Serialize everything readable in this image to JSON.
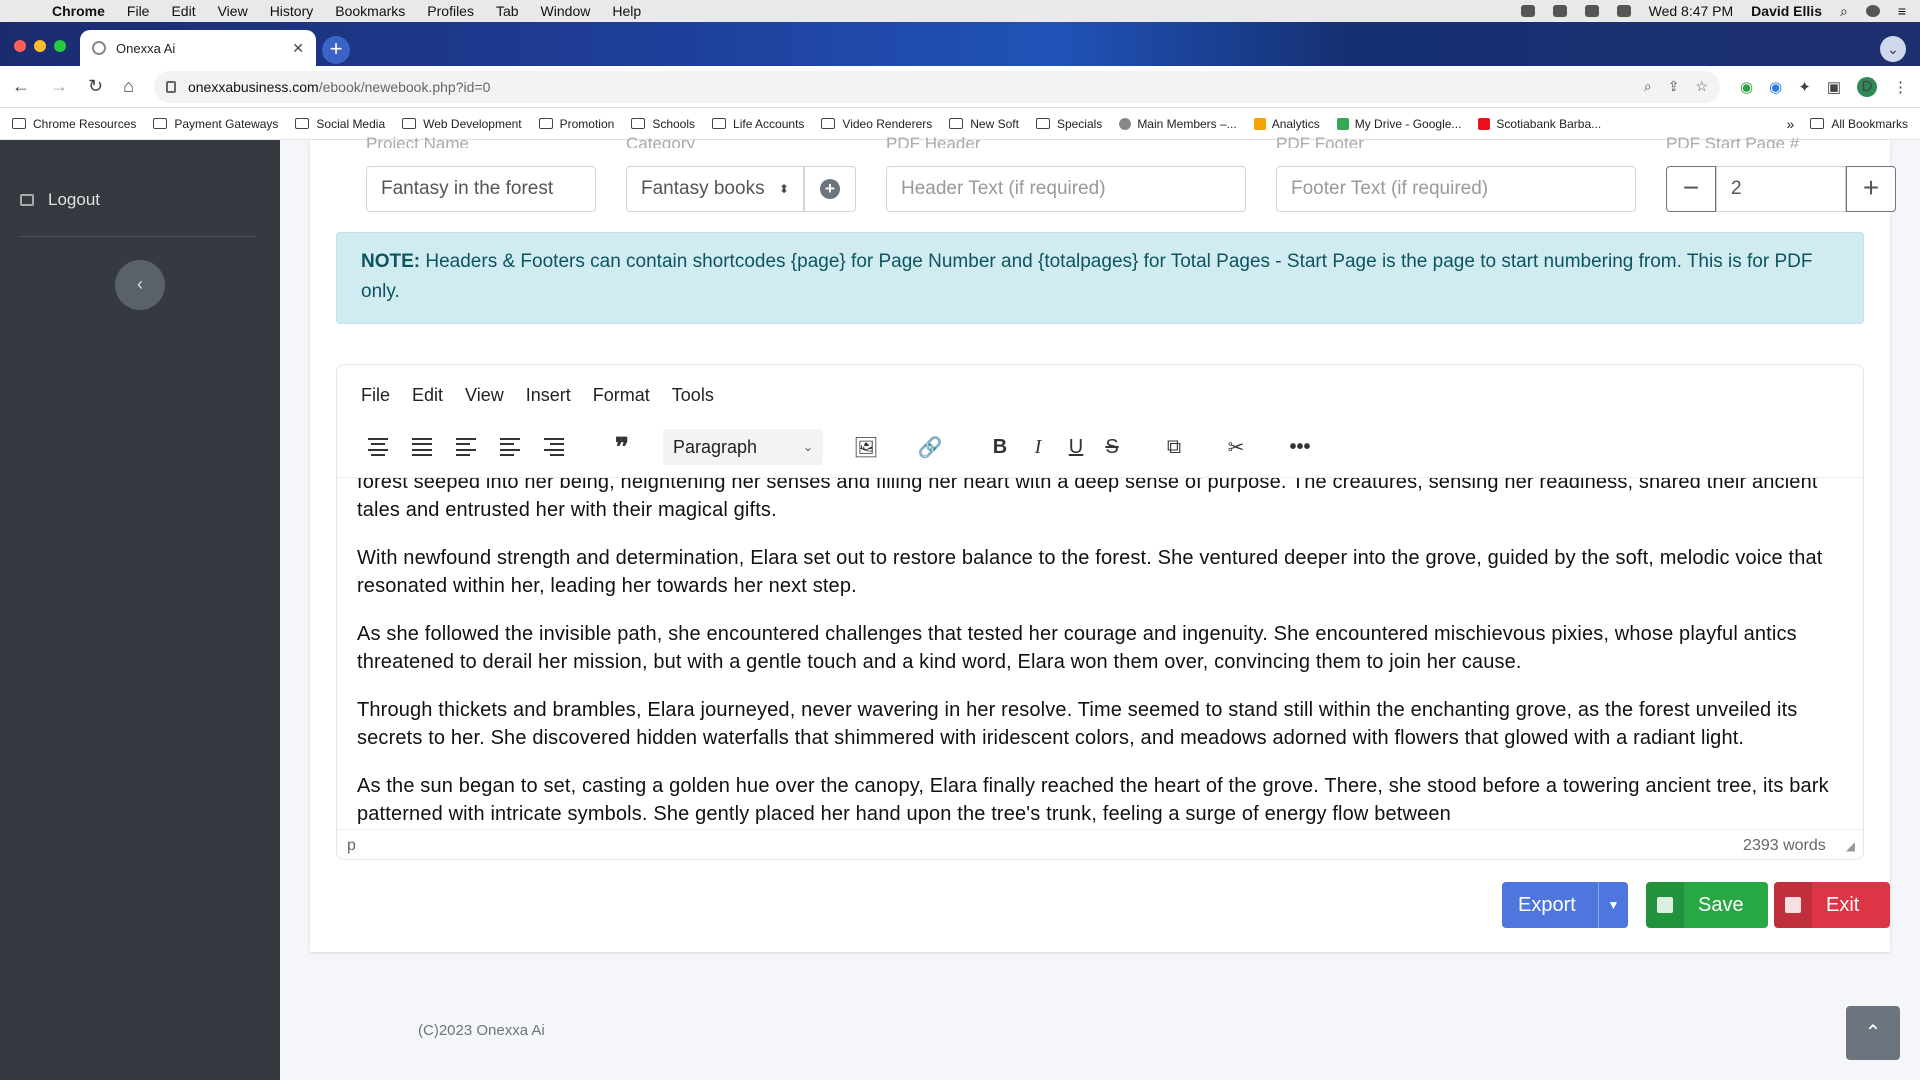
{
  "mac": {
    "app": "Chrome",
    "menu": [
      "File",
      "Edit",
      "View",
      "History",
      "Bookmarks",
      "Profiles",
      "Tab",
      "Window",
      "Help"
    ],
    "clock": "Wed 8:47 PM",
    "user": "David Ellis"
  },
  "browser": {
    "tab_title": "Onexxa Ai",
    "url_domain": "onexxabusiness.com",
    "url_path": "/ebook/newebook.php?id=0",
    "profile_initial": "D",
    "bookmarks": [
      "Chrome Resources",
      "Payment Gateways",
      "Social Media",
      "Web Development",
      "Promotion",
      "Schools",
      "Life Accounts",
      "Video Renderers",
      "New Soft",
      "Specials",
      "Main Members –...",
      "Analytics",
      "My Drive - Google...",
      "Scotiabank Barba..."
    ],
    "all_bookmarks": "All Bookmarks",
    "overflow": "»"
  },
  "sidebar": {
    "logout_label": "Logout"
  },
  "form": {
    "project_label": "Project Name",
    "project_value": "Fantasy in the forest",
    "category_label": "Category",
    "category_value": "Fantasy books",
    "header_label": "PDF Header",
    "header_placeholder": "Header Text (if required)",
    "footer_label": "PDF Footer",
    "footer_placeholder": "Footer Text (if required)",
    "start_label": "PDF Start Page #",
    "start_value": "2"
  },
  "note": {
    "prefix": "NOTE:",
    "text": " Headers & Footers can contain shortcodes {page} for Page Number and {totalpages} for Total Pages - Start Page is the page to start numbering from. This is for PDF only."
  },
  "editor": {
    "menu": [
      "File",
      "Edit",
      "View",
      "Insert",
      "Format",
      "Tools"
    ],
    "block_format": "Paragraph",
    "paragraphs": [
      "forest seeped into her being, heightening her senses and filling her heart with a deep sense of purpose. The creatures, sensing her readiness, shared their ancient tales and entrusted her with their magical gifts.",
      "With newfound strength and determination, Elara set out to restore balance to the forest. She ventured deeper into the grove, guided by the soft, melodic voice that resonated within her, leading her towards her next step.",
      "As she followed the invisible path, she encountered challenges that tested her courage and ingenuity. She encountered mischievous pixies, whose playful antics threatened to derail her mission, but with a gentle touch and a kind word, Elara won them over, convincing them to join her cause.",
      "Through thickets and brambles, Elara journeyed, never wavering in her resolve. Time seemed to stand still within the enchanting grove, as the forest unveiled its secrets to her. She discovered hidden waterfalls that shimmered with iridescent colors, and meadows adorned with flowers that glowed with a radiant light.",
      "As the sun began to set, casting a golden hue over the canopy, Elara finally reached the heart of the grove. There, she stood before a towering ancient tree, its bark patterned with intricate symbols. She gently placed her hand upon the tree's trunk, feeling a surge of energy flow between"
    ],
    "path": "p",
    "word_count": "2393 words"
  },
  "actions": {
    "export": "Export",
    "save": "Save",
    "exit": "Exit"
  },
  "footer": {
    "copyright": "(C)2023 Onexxa Ai"
  },
  "colors": {
    "sidebar": "#343a40",
    "export": "#4f75de",
    "save": "#28a745",
    "exit": "#dc3545",
    "note_bg": "#d1ecf1"
  }
}
